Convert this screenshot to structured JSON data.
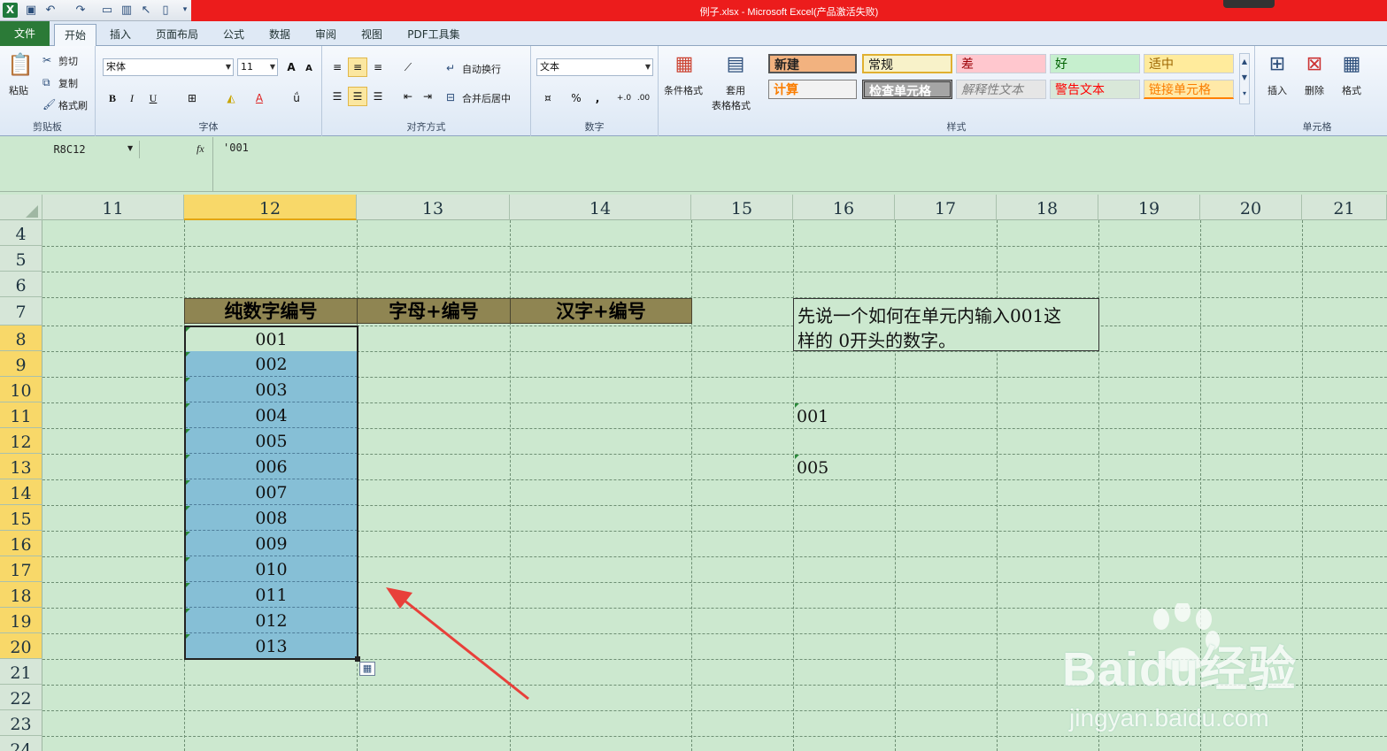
{
  "window": {
    "title": "例子.xlsx - Microsoft Excel(产品激活失败)"
  },
  "ribbon": {
    "tabs": [
      "文件",
      "开始",
      "插入",
      "页面布局",
      "公式",
      "数据",
      "审阅",
      "视图",
      "PDF工具集"
    ],
    "clipboard": {
      "paste": "粘贴",
      "cut": "剪切",
      "copy": "复制",
      "format_painter": "格式刷",
      "label": "剪贴板"
    },
    "font": {
      "name": "宋体",
      "size": "11",
      "label": "字体",
      "bold": "B",
      "italic": "I",
      "underline": "U",
      "grow": "A",
      "shrink": "A"
    },
    "alignment": {
      "wrap": "自动换行",
      "merge": "合并后居中",
      "label": "对齐方式"
    },
    "number": {
      "format": "文本",
      "percent": "%",
      "comma": ",",
      "label": "数字"
    },
    "styles": {
      "conditional": "条件格式",
      "table_format_1": "套用",
      "table_format_2": "表格格式",
      "cells": [
        "新建",
        "常规",
        "差",
        "好",
        "适中",
        "计算",
        "检查单元格",
        "解释性文本",
        "警告文本",
        "链接单元格"
      ],
      "label": "样式"
    },
    "cells_group": {
      "insert": "插入",
      "delete": "删除",
      "format": "格式",
      "label": "单元格"
    }
  },
  "formula_bar": {
    "name_box": "R8C12",
    "fx": "fx",
    "value": "'001"
  },
  "sheet": {
    "columns": [
      "11",
      "12",
      "13",
      "14",
      "15",
      "16",
      "17",
      "18",
      "19",
      "20",
      "21"
    ],
    "rows": [
      "4",
      "5",
      "6",
      "7",
      "8",
      "9",
      "10",
      "11",
      "12",
      "13",
      "14",
      "15",
      "16",
      "17",
      "18",
      "19",
      "20",
      "21",
      "22",
      "23",
      "24"
    ],
    "headers": [
      "纯数字编号",
      "字母+编号",
      "汉字+编号"
    ],
    "numbers": [
      "001",
      "002",
      "003",
      "004",
      "005",
      "006",
      "007",
      "008",
      "009",
      "010",
      "011",
      "012",
      "013"
    ],
    "note_line1": "先说一个如何在单元内输入001这",
    "note_line2": "样的 0开头的数字。",
    "side_value_1": "001",
    "side_value_2": "005"
  },
  "watermark": {
    "brand": "Baidu经验",
    "url": "jingyan.baidu.com"
  },
  "colors": {
    "selection": "#86bfd6",
    "header_fill": "#8f8552",
    "sheet_bg": "#cce8cf",
    "arrow": "#e8403a",
    "title_bar": "#ec1c1c"
  }
}
